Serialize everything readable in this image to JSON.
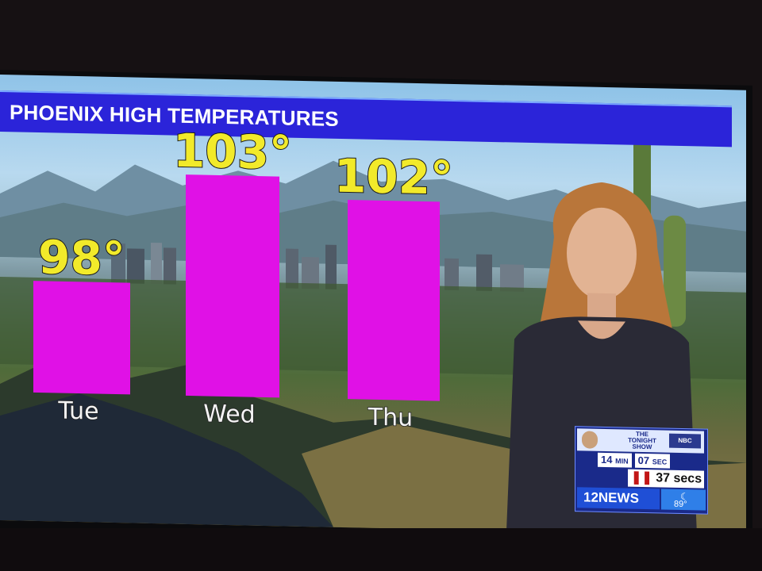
{
  "banner": {
    "title": "PHOENIX HIGH TEMPERATURES"
  },
  "chart_data": {
    "type": "bar",
    "title": "PHOENIX HIGH TEMPERATURES",
    "categories": [
      "Tue",
      "Wed",
      "Thu"
    ],
    "values": [
      98,
      103,
      102
    ],
    "value_labels": [
      "98°",
      "103°",
      "102°"
    ],
    "bar_color": "#e011e6",
    "label_color": "#f2ea2a",
    "xlabel": "",
    "ylabel": "",
    "legend": "none",
    "grid": false
  },
  "promo": {
    "show": "THE TONIGHT SHOW",
    "countdown_min": "14",
    "min_unit": "MIN",
    "countdown_sec": "07",
    "sec_unit": "SEC",
    "secs_remaining": "37 secs",
    "station": "12NEWS",
    "temperature": "89°"
  }
}
